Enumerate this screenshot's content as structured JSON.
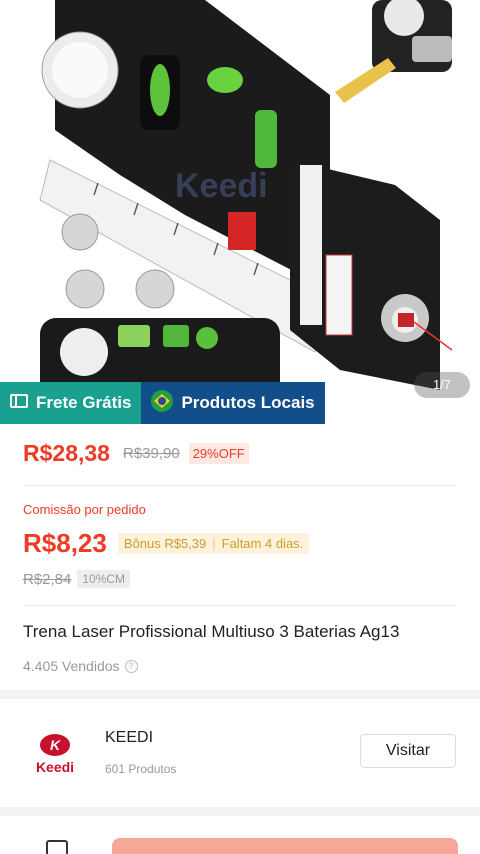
{
  "gallery": {
    "page_indicator": "1/7",
    "watermark": "Keedi"
  },
  "tags": {
    "free_shipping": "Frete Grátis",
    "local_products": "Produtos Locais"
  },
  "price": {
    "current": "R$28,38",
    "original": "R$39,90",
    "discount": "29%OFF"
  },
  "commission": {
    "label": "Comissão por pedido",
    "value": "R$8,23",
    "bonus": "Bônus R$5,39",
    "remaining": "Faltam 4 dias.",
    "old_value": "R$2,84",
    "rate": "10%CM"
  },
  "product": {
    "title": "Trena Laser Profissional Multiuso 3 Baterias Ag13",
    "sold": "4.405 Vendidos"
  },
  "store": {
    "logo_text": "Keedi",
    "name": "KEEDI",
    "product_count": "601 Produtos",
    "visit_label": "Visitar"
  },
  "colors": {
    "accent": "#ee3b26",
    "free_shipping_bg": "#1aa08f",
    "local_products_bg": "#124f8a",
    "bonus_text": "#d69a2a"
  }
}
